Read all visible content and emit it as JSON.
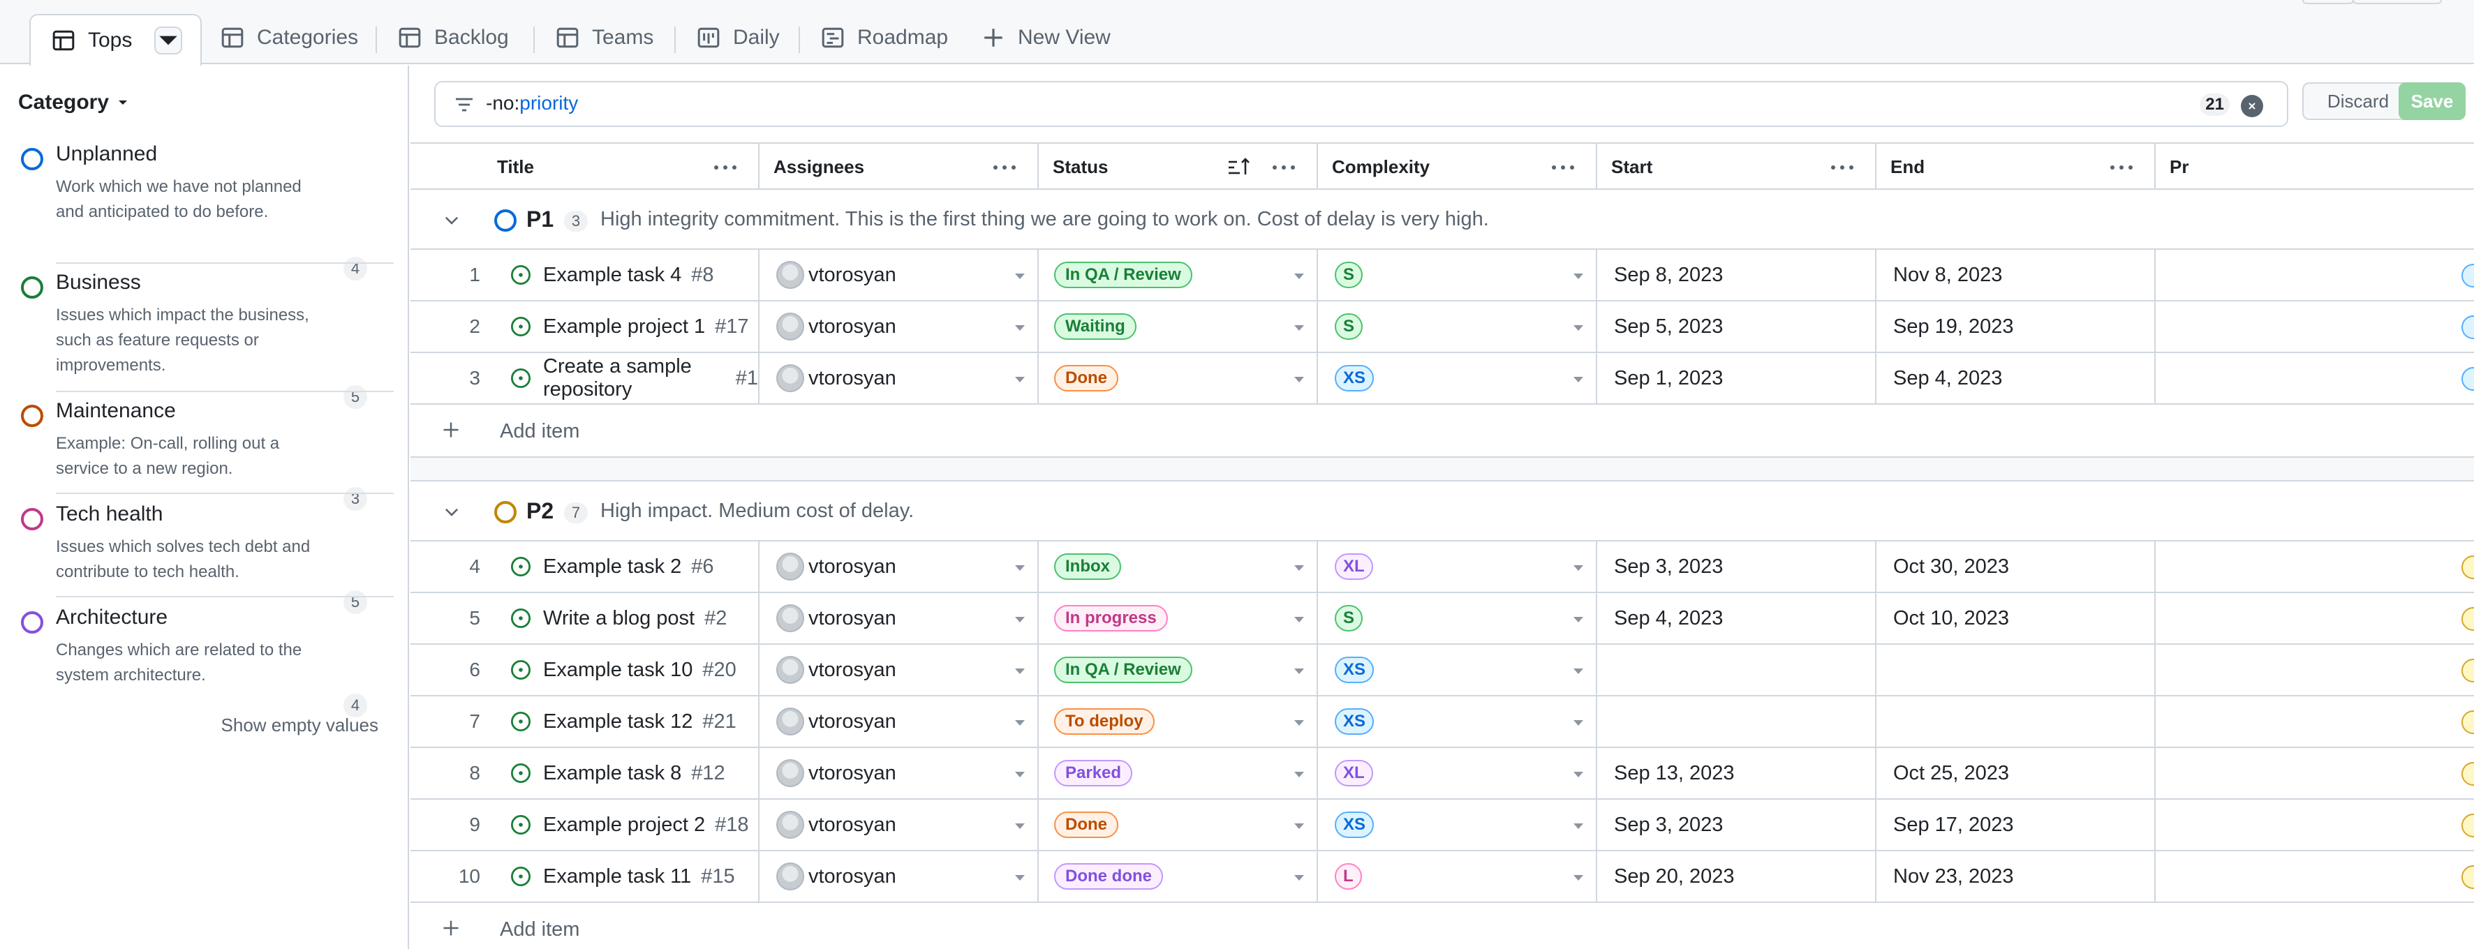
{
  "views": [
    {
      "label": "Tops",
      "icon": "table-icon",
      "active": true
    },
    {
      "label": "Categories",
      "icon": "table-icon"
    },
    {
      "label": "Backlog",
      "icon": "table-icon"
    },
    {
      "label": "Teams",
      "icon": "table-icon"
    },
    {
      "label": "Daily",
      "icon": "board-icon"
    },
    {
      "label": "Roadmap",
      "icon": "roadmap-icon"
    },
    {
      "label": "New View",
      "icon": "plus-icon"
    }
  ],
  "sidebar": {
    "header": "Category",
    "items": [
      {
        "name": "Unplanned",
        "desc": "Work which we have not planned and anticipated to do before.",
        "count": "4",
        "color": "#0969da"
      },
      {
        "name": "Business",
        "desc": "Issues which impact the business, such as feature requests or improvements.",
        "count": "5",
        "color": "#1a7f37"
      },
      {
        "name": "Maintenance",
        "desc": "Example: On-call, rolling out a service to a new region.",
        "count": "3",
        "color": "#bc4c00"
      },
      {
        "name": "Tech health",
        "desc": "Issues which solves tech debt and contribute to tech health.",
        "count": "5",
        "color": "#bf3989"
      },
      {
        "name": "Architecture",
        "desc": "Changes which are related to the system architecture.",
        "count": "4",
        "color": "#8250df"
      }
    ],
    "show_empty": "Show empty values"
  },
  "filter": {
    "prefix": "-no:",
    "qualifier": "priority",
    "count": "21",
    "discard": "Discard",
    "save": "Save"
  },
  "columns": {
    "title": "Title",
    "assignees": "Assignees",
    "status": "Status",
    "complexity": "Complexity",
    "start": "Start",
    "end": "End",
    "priority_partial": "Pr"
  },
  "groups": [
    {
      "name": "P1",
      "count": "3",
      "color": "#0969da",
      "desc": "High integrity commitment. This is the first thing we are going to work on. Cost of delay is very high.",
      "add_item": "Add item",
      "rows": [
        {
          "n": "1",
          "title": "Example task 4",
          "num": "#8",
          "assignee": "vtorosyan",
          "status": "In QA / Review",
          "status_style": "green",
          "cplx": "S",
          "cplx_style": "green",
          "start": "Sep 8, 2023",
          "end": "Nov 8, 2023"
        },
        {
          "n": "2",
          "title": "Example project 1",
          "num": "#17",
          "assignee": "vtorosyan",
          "status": "Waiting",
          "status_style": "green",
          "cplx": "S",
          "cplx_style": "green",
          "start": "Sep 5, 2023",
          "end": "Sep 19, 2023"
        },
        {
          "n": "3",
          "title": "Create a sample repository",
          "num": "#1",
          "assignee": "vtorosyan",
          "status": "Done",
          "status_style": "orange",
          "cplx": "XS",
          "cplx_style": "blue",
          "start": "Sep 1, 2023",
          "end": "Sep 4, 2023"
        }
      ]
    },
    {
      "name": "P2",
      "count": "7",
      "color": "#bf8700",
      "desc": "High impact. Medium cost of delay.",
      "add_item": "Add item",
      "rows": [
        {
          "n": "4",
          "title": "Example task 2",
          "num": "#6",
          "assignee": "vtorosyan",
          "status": "Inbox",
          "status_style": "green",
          "cplx": "XL",
          "cplx_style": "purple",
          "start": "Sep 3, 2023",
          "end": "Oct 30, 2023"
        },
        {
          "n": "5",
          "title": "Write a blog post",
          "num": "#2",
          "assignee": "vtorosyan",
          "status": "In progress",
          "status_style": "pink",
          "cplx": "S",
          "cplx_style": "green",
          "start": "Sep 4, 2023",
          "end": "Oct 10, 2023"
        },
        {
          "n": "6",
          "title": "Example task 10",
          "num": "#20",
          "assignee": "vtorosyan",
          "status": "In QA / Review",
          "status_style": "green",
          "cplx": "XS",
          "cplx_style": "blue",
          "start": "",
          "end": ""
        },
        {
          "n": "7",
          "title": "Example task 12",
          "num": "#21",
          "assignee": "vtorosyan",
          "status": "To deploy",
          "status_style": "orange",
          "cplx": "XS",
          "cplx_style": "blue",
          "start": "",
          "end": ""
        },
        {
          "n": "8",
          "title": "Example task 8",
          "num": "#12",
          "assignee": "vtorosyan",
          "status": "Parked",
          "status_style": "purple",
          "cplx": "XL",
          "cplx_style": "purple",
          "start": "Sep 13, 2023",
          "end": "Oct 25, 2023"
        },
        {
          "n": "9",
          "title": "Example project 2",
          "num": "#18",
          "assignee": "vtorosyan",
          "status": "Done",
          "status_style": "orange",
          "cplx": "XS",
          "cplx_style": "blue",
          "start": "Sep 3, 2023",
          "end": "Sep 17, 2023"
        },
        {
          "n": "10",
          "title": "Example task 11",
          "num": "#15",
          "assignee": "vtorosyan",
          "status": "Done done",
          "status_style": "purple",
          "cplx": "L",
          "cplx_style": "pink",
          "start": "Sep 20, 2023",
          "end": "Nov 23, 2023"
        }
      ]
    }
  ],
  "pill_colors": {
    "green": {
      "fg": "#1a7f37",
      "bg": "#dafbe1",
      "border": "#4ac26b"
    },
    "orange": {
      "fg": "#bc4c00",
      "bg": "#fff1e5",
      "border": "#fb8f44"
    },
    "blue": {
      "fg": "#0969da",
      "bg": "#ddf4ff",
      "border": "#54aeff"
    },
    "purple": {
      "fg": "#8250df",
      "bg": "#fbefff",
      "border": "#c297ff"
    },
    "pink": {
      "fg": "#bf3989",
      "bg": "#ffeff7",
      "border": "#ff80c8"
    }
  }
}
